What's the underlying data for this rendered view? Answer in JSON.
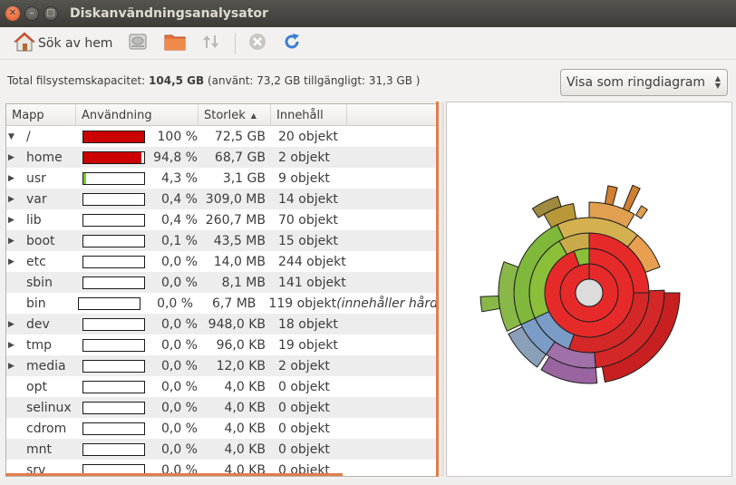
{
  "window": {
    "title": "Diskanvändningsanalysator"
  },
  "toolbar": {
    "scan_home_label": "Sök av hem",
    "scan_home_icon": "home-icon",
    "scan_filesystem_icon": "harddisk-icon",
    "scan_folder_icon": "folder-icon",
    "scan_remote_icon": "network-icon",
    "stop_icon": "stop-icon",
    "refresh_icon": "refresh-icon"
  },
  "info": {
    "capacity_label": "Total filsystemskapacitet:",
    "capacity_total": "104,5 GB",
    "capacity_detail": "(använt: 73,2 GB tillgängligt: 31,3 GB )"
  },
  "view_select": {
    "selected": "Visa som ringdiagram"
  },
  "table": {
    "columns": {
      "folder": "Mapp",
      "usage": "Användning",
      "size": "Storlek",
      "contents": "Innehåll"
    },
    "rows": [
      {
        "expander": "▼",
        "name": "/",
        "usage": 1.0,
        "percent": "100 %",
        "size": "72,5 GB",
        "contents": "20 objekt",
        "extra": "",
        "indent": 0
      },
      {
        "expander": "▶",
        "name": "home",
        "usage": 0.948,
        "percent": "94,8 %",
        "size": "68,7 GB",
        "contents": "2 objekt",
        "extra": "",
        "indent": 1
      },
      {
        "expander": "▶",
        "name": "usr",
        "usage": 0.043,
        "percent": "4,3 %",
        "size": "3,1 GB",
        "contents": "9 objekt",
        "extra": "",
        "indent": 1
      },
      {
        "expander": "▶",
        "name": "var",
        "usage": 0.004,
        "percent": "0,4 %",
        "size": "309,0 MB",
        "contents": "14 objekt",
        "extra": "",
        "indent": 1
      },
      {
        "expander": "▶",
        "name": "lib",
        "usage": 0.004,
        "percent": "0,4 %",
        "size": "260,7 MB",
        "contents": "70 objekt",
        "extra": "",
        "indent": 1
      },
      {
        "expander": "▶",
        "name": "boot",
        "usage": 0.001,
        "percent": "0,1 %",
        "size": "43,5 MB",
        "contents": "15 objekt",
        "extra": "",
        "indent": 1
      },
      {
        "expander": "▶",
        "name": "etc",
        "usage": 0.0,
        "percent": "0,0 %",
        "size": "14,0 MB",
        "contents": "244 objekt",
        "extra": "",
        "indent": 1
      },
      {
        "expander": "",
        "name": "sbin",
        "usage": 0.0,
        "percent": "0,0 %",
        "size": "8,1 MB",
        "contents": "141 objekt",
        "extra": "",
        "indent": 1
      },
      {
        "expander": "",
        "name": "bin",
        "usage": 0.0,
        "percent": "0,0 %",
        "size": "6,7 MB",
        "contents": "119 objekt",
        "extra": "(innehåller hård",
        "indent": 1
      },
      {
        "expander": "▶",
        "name": "dev",
        "usage": 0.0,
        "percent": "0,0 %",
        "size": "948,0 KB",
        "contents": "18 objekt",
        "extra": "",
        "indent": 1
      },
      {
        "expander": "▶",
        "name": "tmp",
        "usage": 0.0,
        "percent": "0,0 %",
        "size": "96,0 KB",
        "contents": "19 objekt",
        "extra": "",
        "indent": 1
      },
      {
        "expander": "▶",
        "name": "media",
        "usage": 0.0,
        "percent": "0,0 %",
        "size": "12,0 KB",
        "contents": "2 objekt",
        "extra": "",
        "indent": 1
      },
      {
        "expander": "",
        "name": "opt",
        "usage": 0.0,
        "percent": "0,0 %",
        "size": "4,0 KB",
        "contents": "0 objekt",
        "extra": "",
        "indent": 1
      },
      {
        "expander": "",
        "name": "selinux",
        "usage": 0.0,
        "percent": "0,0 %",
        "size": "4,0 KB",
        "contents": "0 objekt",
        "extra": "",
        "indent": 1
      },
      {
        "expander": "",
        "name": "cdrom",
        "usage": 0.0,
        "percent": "0,0 %",
        "size": "4,0 KB",
        "contents": "0 objekt",
        "extra": "",
        "indent": 1
      },
      {
        "expander": "",
        "name": "mnt",
        "usage": 0.0,
        "percent": "0,0 %",
        "size": "4,0 KB",
        "contents": "0 objekt",
        "extra": "",
        "indent": 1
      },
      {
        "expander": "",
        "name": "srv",
        "usage": 0.0,
        "percent": "0,0 %",
        "size": "4,0 KB",
        "contents": "0 objekt",
        "extra": "",
        "indent": 1
      }
    ]
  },
  "ring_chart": {
    "center_color": "#dcdcdc",
    "rings": [
      {
        "level": 1,
        "segments": [
          {
            "start": 0,
            "end": 360,
            "color": "#e62a2a"
          }
        ]
      },
      {
        "level": 2,
        "segments": [
          {
            "start": 0,
            "end": 340,
            "color": "#e62a2a"
          },
          {
            "start": 340,
            "end": 360,
            "color": "#8bbf3a"
          }
        ]
      },
      {
        "level": 3,
        "segments": [
          {
            "start": 0,
            "end": 90,
            "color": "#e62a2a"
          },
          {
            "start": 90,
            "end": 200,
            "color": "#d42828"
          },
          {
            "start": 200,
            "end": 245,
            "color": "#7a9cc6"
          },
          {
            "start": 245,
            "end": 330,
            "color": "#8bbf3a"
          },
          {
            "start": 330,
            "end": 360,
            "color": "#c9a94a"
          }
        ]
      },
      {
        "level": 4,
        "segments": [
          {
            "start": 88,
            "end": 175,
            "color": "#d42828"
          },
          {
            "start": 175,
            "end": 215,
            "color": "#a070a8"
          },
          {
            "start": 215,
            "end": 245,
            "color": "#7a9cc6"
          },
          {
            "start": 245,
            "end": 335,
            "color": "#7fb83a"
          },
          {
            "start": 335,
            "end": 40,
            "color": "#d4b050"
          },
          {
            "start": 40,
            "end": 70,
            "color": "#e8a050"
          }
        ]
      },
      {
        "level": 5,
        "segments": [
          {
            "start": 90,
            "end": 170,
            "color": "#c82020"
          },
          {
            "start": 175,
            "end": 212,
            "color": "#9a64a0"
          },
          {
            "start": 215,
            "end": 243,
            "color": "#8aa0b8"
          },
          {
            "start": 245,
            "end": 290,
            "color": "#8ab848"
          },
          {
            "start": 330,
            "end": 350,
            "color": "#b89838"
          },
          {
            "start": 0,
            "end": 30,
            "color": "#e0a050"
          }
        ]
      }
    ],
    "spikes": [
      {
        "start": 326,
        "end": 342,
        "color": "#a08a40"
      },
      {
        "start": 10,
        "end": 15,
        "color": "#d08030"
      },
      {
        "start": 22,
        "end": 26,
        "color": "#d08030"
      },
      {
        "start": 31,
        "end": 35,
        "color": "#e0a050"
      },
      {
        "start": 260,
        "end": 268,
        "color": "#8ab848"
      }
    ]
  }
}
